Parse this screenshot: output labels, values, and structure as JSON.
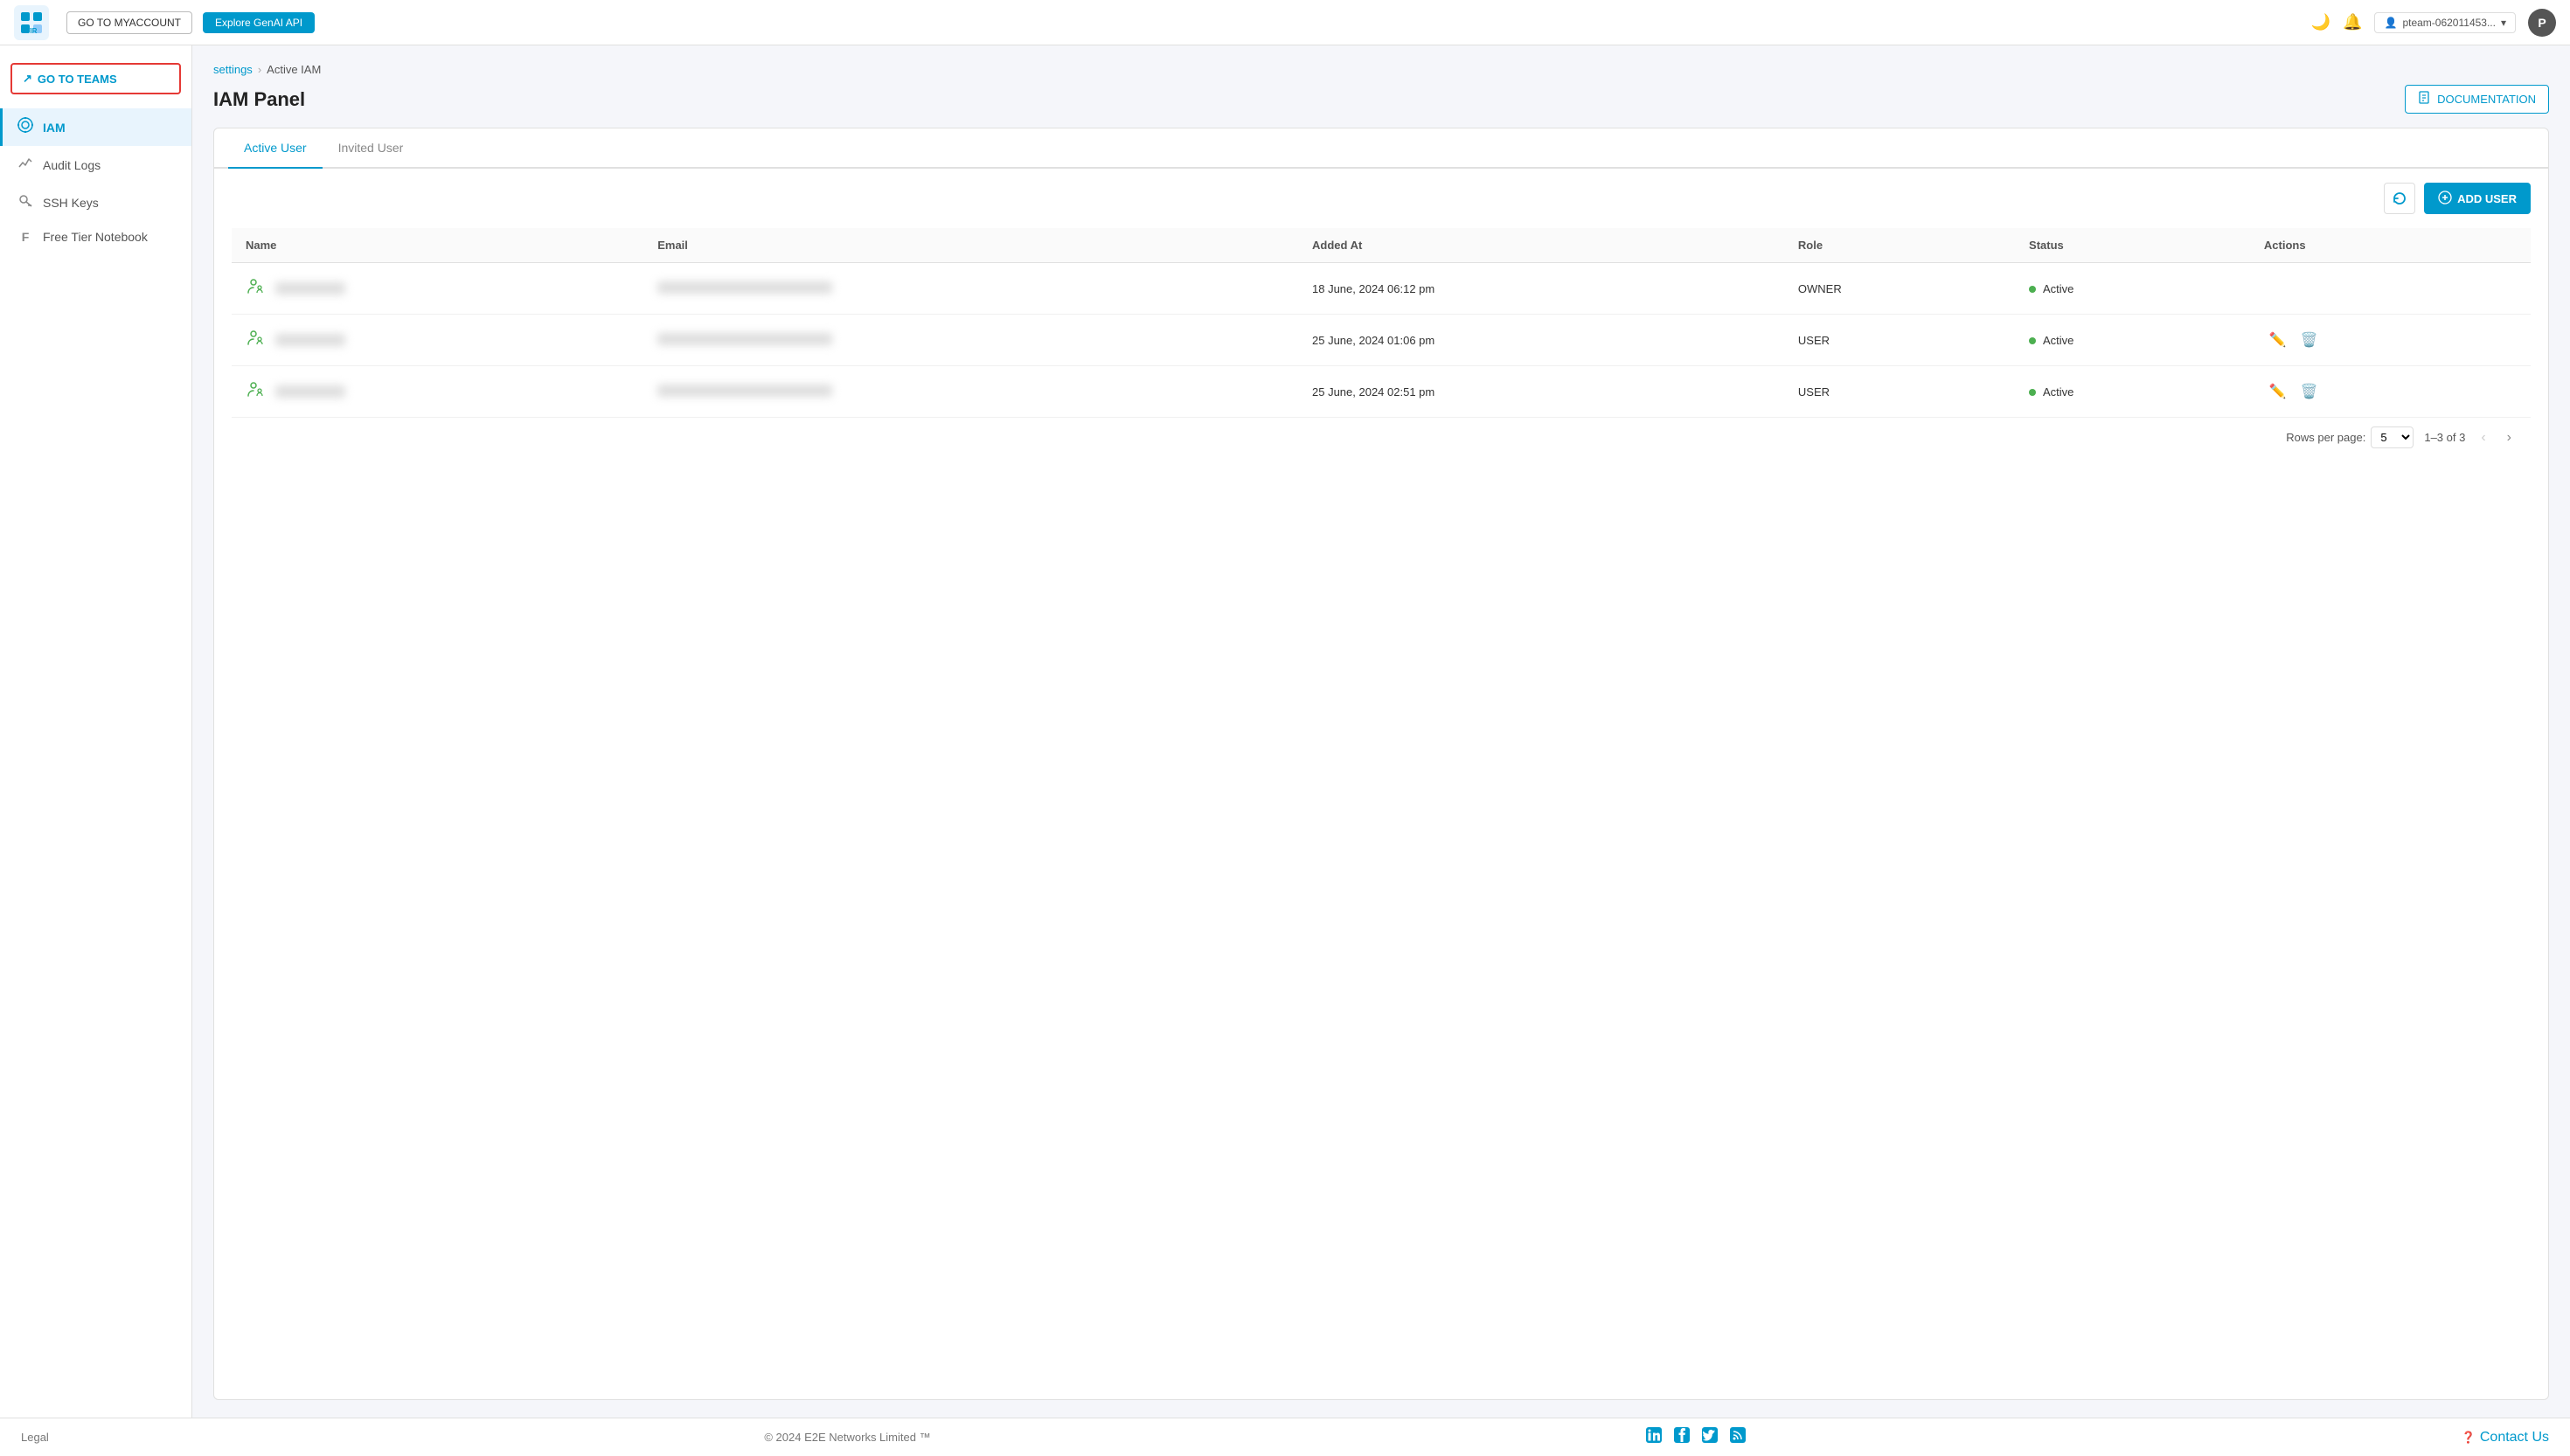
{
  "topnav": {
    "logo_alt": "TIR AI Platform",
    "btn_myaccount": "GO TO MYACCOUNT",
    "btn_genai": "Explore GenAI API",
    "account_name": "pteam-062011453...",
    "avatar_letter": "P"
  },
  "sidebar": {
    "teams_btn": "GO TO TEAMS",
    "items": [
      {
        "id": "iam",
        "label": "IAM",
        "icon": "⚙"
      },
      {
        "id": "audit-logs",
        "label": "Audit Logs",
        "icon": "📈"
      },
      {
        "id": "ssh-keys",
        "label": "SSH Keys",
        "icon": "🔑"
      },
      {
        "id": "free-tier",
        "label": "Free Tier Notebook",
        "icon": "F"
      }
    ],
    "active": "iam"
  },
  "breadcrumb": {
    "parent": "settings",
    "current": "Active IAM"
  },
  "page": {
    "title": "IAM Panel",
    "doc_btn": "DOCUMENTATION"
  },
  "tabs": [
    {
      "id": "active-user",
      "label": "Active User",
      "active": true
    },
    {
      "id": "invited-user",
      "label": "Invited User",
      "active": false
    }
  ],
  "table": {
    "columns": [
      "Name",
      "Email",
      "Added At",
      "Role",
      "Status",
      "Actions"
    ],
    "rows": [
      {
        "name_blur": true,
        "email_blur": true,
        "added_at": "18 June, 2024 06:12 pm",
        "role": "OWNER",
        "status": "Active",
        "show_actions": false
      },
      {
        "name_blur": true,
        "email_blur": true,
        "added_at": "25 June, 2024 01:06 pm",
        "role": "USER",
        "status": "Active",
        "show_actions": true
      },
      {
        "name_blur": true,
        "email_blur": true,
        "added_at": "25 June, 2024 02:51 pm",
        "role": "USER",
        "status": "Active",
        "show_actions": true
      }
    ]
  },
  "pagination": {
    "rows_per_page_label": "Rows per page:",
    "rows_per_page_value": "5",
    "range": "1–3 of 3"
  },
  "footer": {
    "legal": "Legal",
    "copyright": "© 2024 E2E Networks Limited ™",
    "contact": "Contact Us",
    "social_links": [
      "linkedin",
      "facebook",
      "twitter",
      "rss"
    ]
  }
}
